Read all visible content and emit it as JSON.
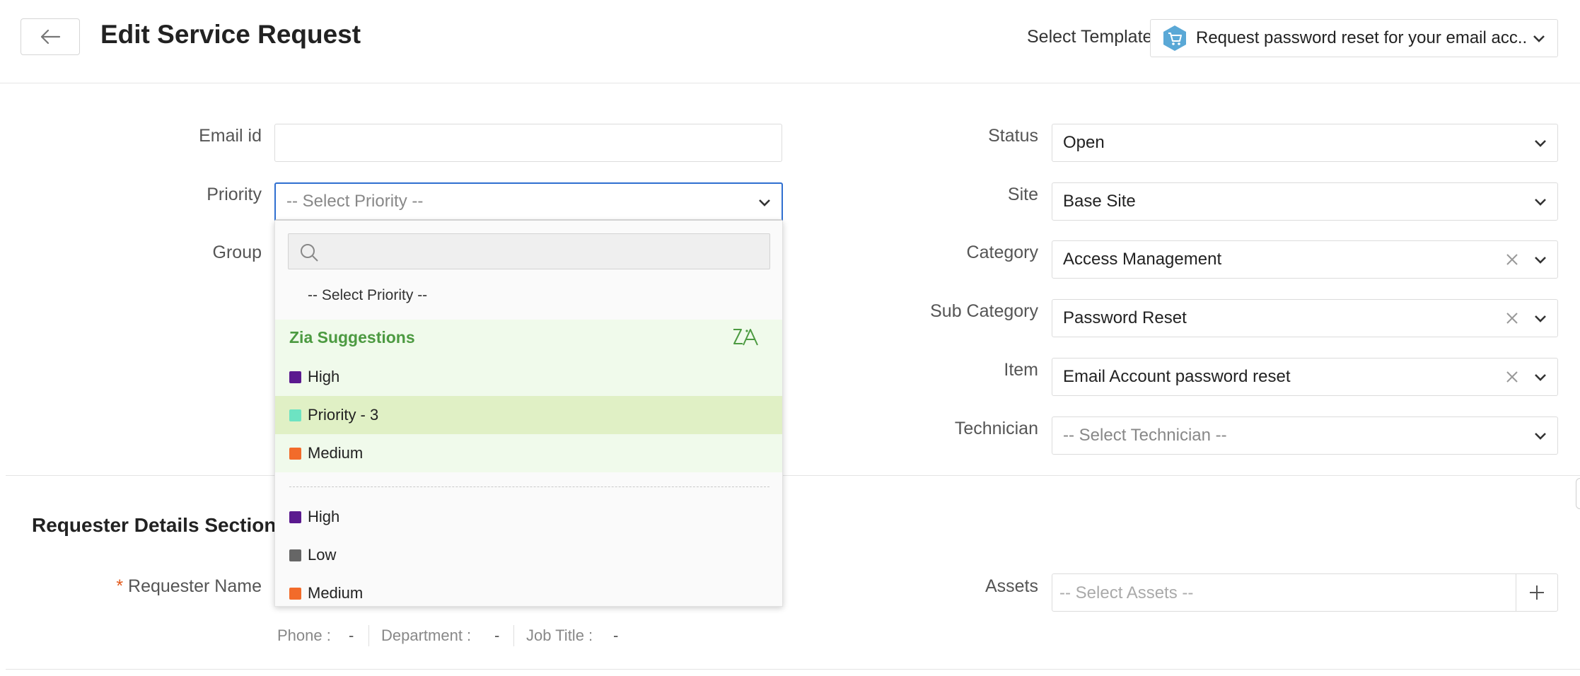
{
  "header": {
    "title": "Edit Service Request",
    "template_label": "Select Template",
    "template_value": "Request password reset for your email acc...",
    "template_icon": "shopping-cart-icon"
  },
  "left_fields": {
    "email_label": "Email id",
    "email_value": "",
    "priority_label": "Priority",
    "priority_placeholder": "-- Select Priority --",
    "group_label": "Group"
  },
  "right_fields": {
    "status_label": "Status",
    "status_value": "Open",
    "site_label": "Site",
    "site_value": "Base Site",
    "category_label": "Category",
    "category_value": "Access Management",
    "subcategory_label": "Sub Category",
    "subcategory_value": "Password Reset",
    "item_label": "Item",
    "item_value": "Email Account password reset",
    "technician_label": "Technician",
    "technician_placeholder": "-- Select Technician --"
  },
  "priority_dropdown": {
    "search_value": "",
    "placeholder_option": "-- Select Priority --",
    "zia_title": "Zia Suggestions",
    "zia_options": [
      {
        "label": "High",
        "color": "#5b1a8f"
      },
      {
        "label": "Priority - 3",
        "color": "#6de3c2"
      },
      {
        "label": "Medium",
        "color": "#f26b2a"
      }
    ],
    "options": [
      {
        "label": "High",
        "color": "#5b1a8f"
      },
      {
        "label": "Low",
        "color": "#666666"
      },
      {
        "label": "Medium",
        "color": "#f26b2a"
      }
    ],
    "highlighted_index": 1
  },
  "requester": {
    "section_title": "Requester Details Section",
    "required_marker": "*",
    "name_label": "Requester Name",
    "phone_label": "Phone :",
    "phone_value": "-",
    "department_label": "Department :",
    "department_value": "-",
    "job_title_label": "Job Title :",
    "job_title_value": "-",
    "assets_label": "Assets",
    "assets_placeholder": "-- Select Assets --"
  },
  "colors": {
    "accent_border": "#2f6fd0",
    "zia_green": "#4c9a41",
    "zia_bg": "#f0faeb",
    "highlight_bg": "#e0f0c5",
    "required_star": "#e25a1c"
  }
}
